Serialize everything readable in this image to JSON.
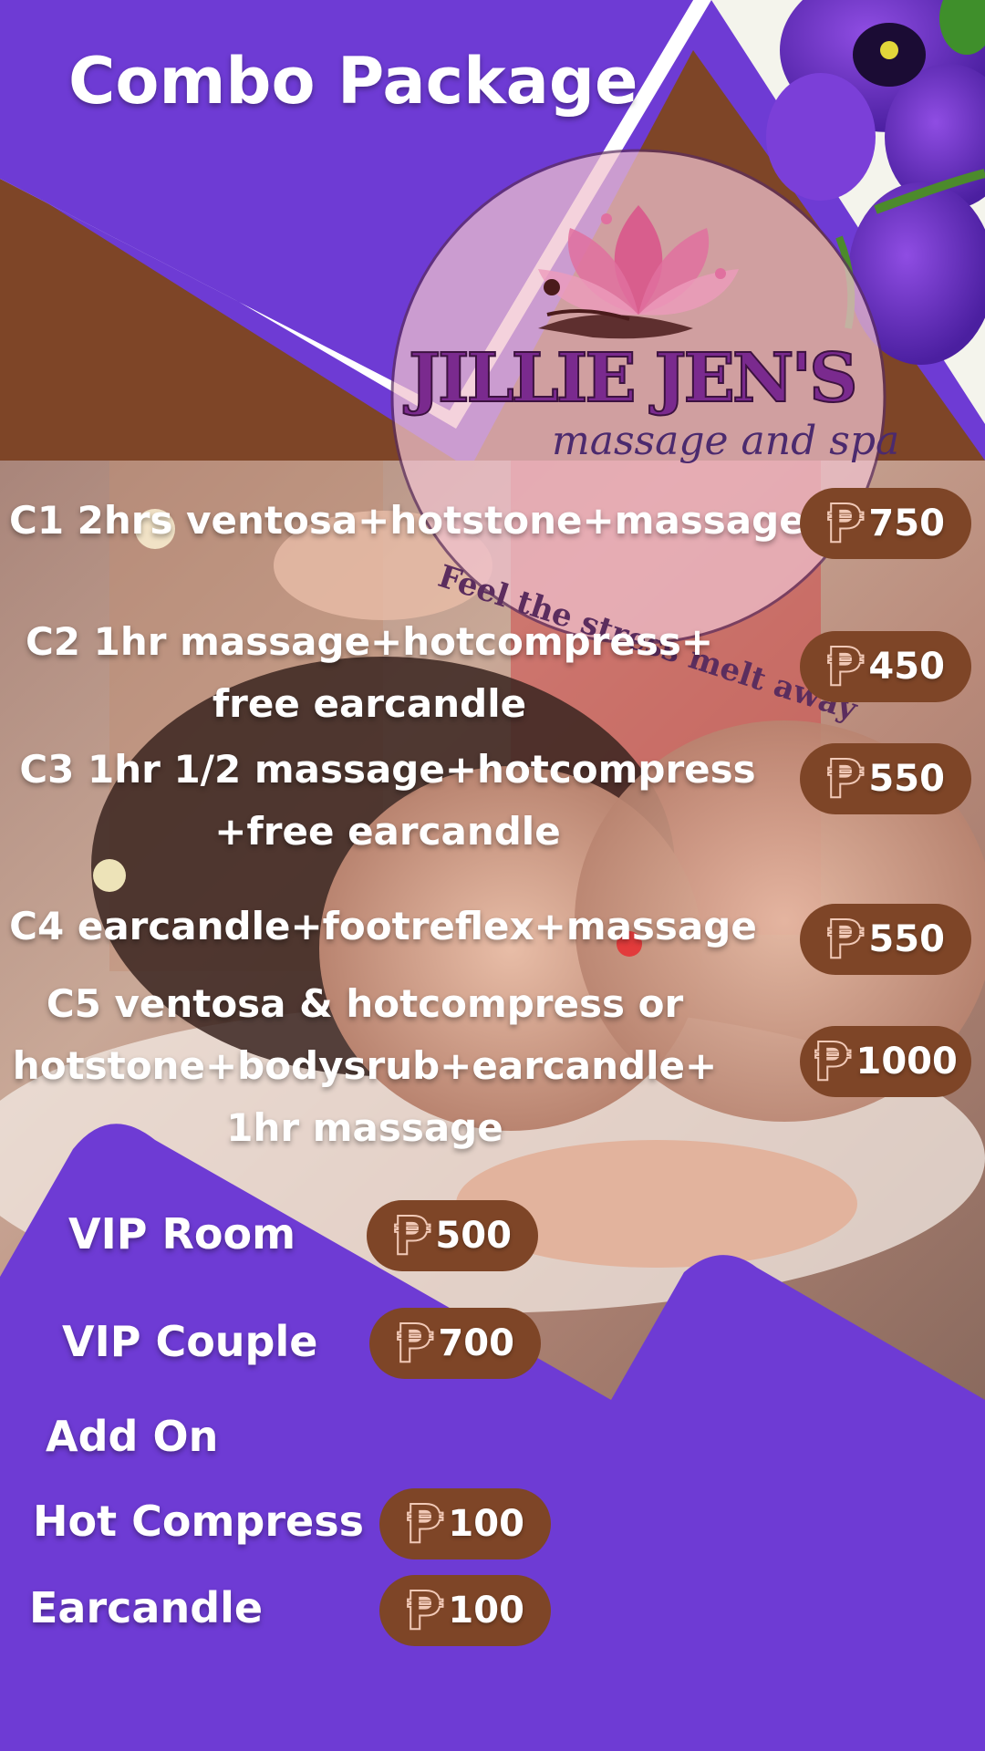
{
  "header": {
    "title": "Combo Package"
  },
  "logo": {
    "brand": "JILLIE JEN'S",
    "subtitle": "massage and spa",
    "tagline": "Feel the stress melt away"
  },
  "currency": "₱",
  "combos": [
    {
      "lines": [
        "C1 2hrs ventosa+hotstone+massage"
      ],
      "price": "750"
    },
    {
      "lines": [
        "C2 1hr massage+hotcompress+",
        "free earcandle"
      ],
      "price": "450"
    },
    {
      "lines": [
        "C3 1hr 1/2 massage+hotcompress",
        "+free earcandle"
      ],
      "price": "550"
    },
    {
      "lines": [
        "C4 earcandle+footreflex+massage"
      ],
      "price": "550"
    },
    {
      "lines": [
        "C5 ventosa & hotcompress or",
        "hotstone+bodysrub+earcandle+",
        "1hr massage"
      ],
      "price": "1000"
    }
  ],
  "rooms": [
    {
      "label": "VIP Room",
      "price": "500"
    },
    {
      "label": "VIP Couple",
      "price": "700"
    }
  ],
  "addon": {
    "heading": "Add On",
    "items": [
      {
        "label": "Hot Compress",
        "price": "100"
      },
      {
        "label": "Earcandle",
        "price": "100"
      }
    ]
  },
  "colors": {
    "purple": "#6e3bd4",
    "brown": "#7e4527",
    "white": "#ffffff",
    "logo_pink": "#c0357f",
    "logo_purple": "#5b1f6b"
  }
}
